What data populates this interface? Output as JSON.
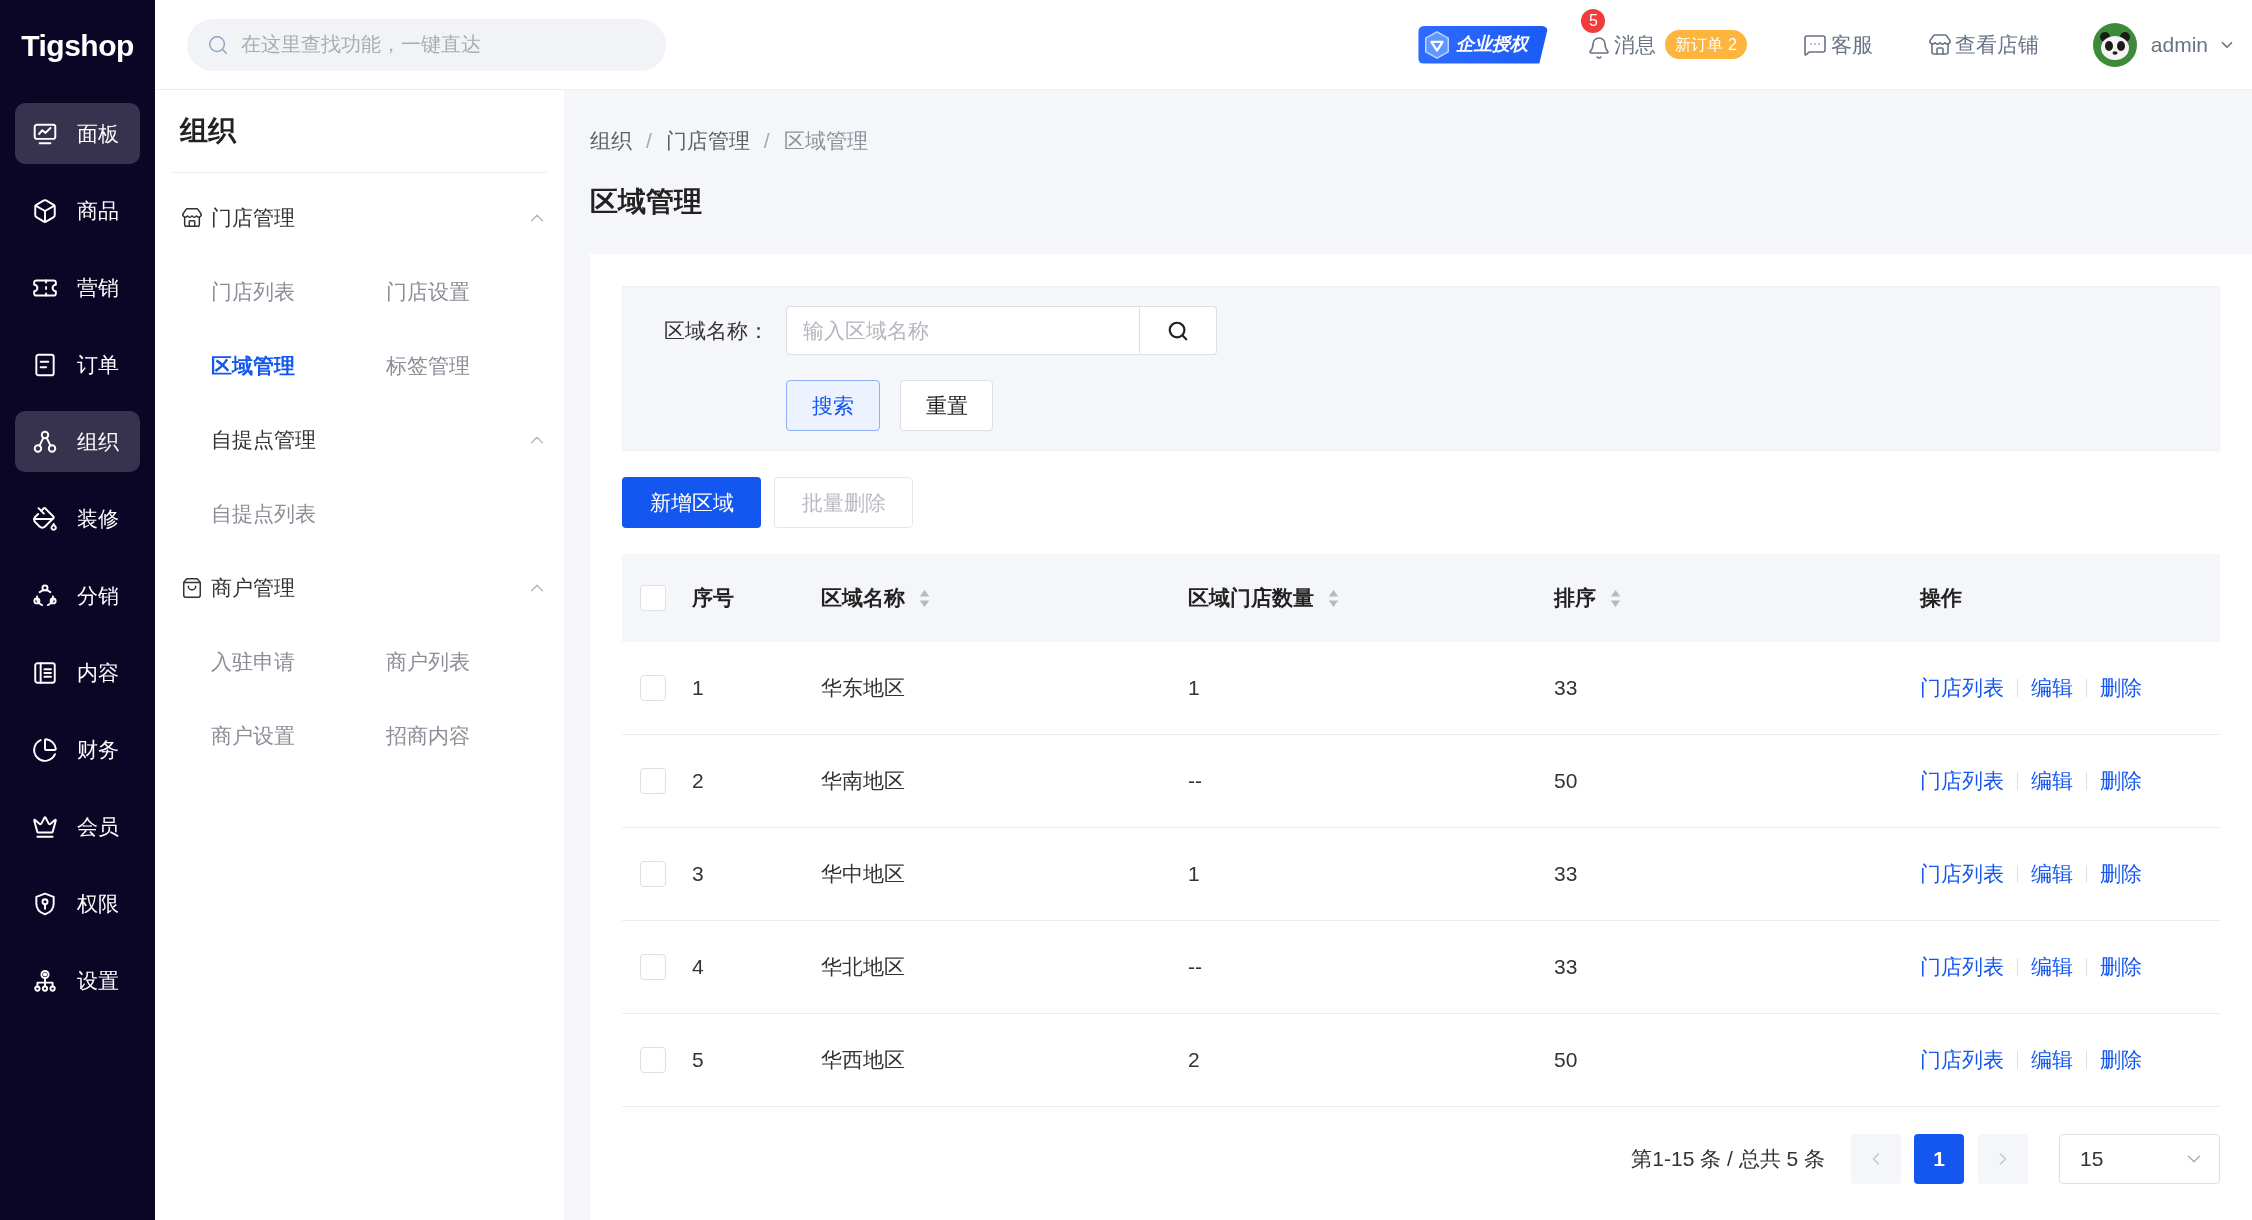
{
  "logo": {
    "text": "Tigshop"
  },
  "topbar": {
    "search": {
      "placeholder": "在这里查找功能，一键直达"
    },
    "license_badge": "企业授权",
    "messages": {
      "label": "消息",
      "count": "5"
    },
    "new_orders": "新订单 2",
    "service": "客服",
    "view_store": "查看店铺",
    "user": {
      "name": "admin"
    }
  },
  "sidebar": {
    "items": [
      {
        "label": "面板",
        "selected": true
      },
      {
        "label": "商品",
        "selected": false
      },
      {
        "label": "营销",
        "selected": false
      },
      {
        "label": "订单",
        "selected": false
      },
      {
        "label": "组织",
        "selected": true
      },
      {
        "label": "装修",
        "selected": false
      },
      {
        "label": "分销",
        "selected": false
      },
      {
        "label": "内容",
        "selected": false
      },
      {
        "label": "财务",
        "selected": false
      },
      {
        "label": "会员",
        "selected": false
      },
      {
        "label": "权限",
        "selected": false
      },
      {
        "label": "设置",
        "selected": false
      }
    ]
  },
  "submenu": {
    "title": "组织",
    "groups": [
      {
        "label": "门店管理",
        "expanded": true,
        "children": [
          {
            "label": "门店列表",
            "selected": false
          },
          {
            "label": "门店设置",
            "selected": false
          },
          {
            "label": "区域管理",
            "selected": true
          },
          {
            "label": "标签管理",
            "selected": false
          },
          {
            "label": "自提点管理",
            "expanded": true,
            "children": [
              {
                "label": "自提点列表",
                "selected": false
              }
            ]
          }
        ]
      },
      {
        "label": "商户管理",
        "expanded": true,
        "children": [
          {
            "label": "入驻申请",
            "selected": false
          },
          {
            "label": "商户列表",
            "selected": false
          },
          {
            "label": "商户设置",
            "selected": false
          },
          {
            "label": "招商内容",
            "selected": false
          }
        ]
      }
    ]
  },
  "breadcrumb": {
    "separator": "/",
    "items": [
      "组织",
      "门店管理",
      "区域管理"
    ]
  },
  "page_title": "区域管理",
  "filter": {
    "label": "区域名称：",
    "placeholder": "输入区域名称",
    "search_button": "搜索",
    "reset_button": "重置"
  },
  "actions": {
    "add_button": "新增区域",
    "batch_delete": {
      "label": "批量删除",
      "disabled": true
    }
  },
  "table": {
    "select_all": {
      "checked": false
    },
    "columns": [
      {
        "label": "序号",
        "sortable": false
      },
      {
        "label": "区域名称",
        "sortable": true
      },
      {
        "label": "区域门店数量",
        "sortable": true
      },
      {
        "label": "排序",
        "sortable": true
      },
      {
        "label": "操作",
        "sortable": false
      }
    ],
    "rows": [
      {
        "checked": false,
        "cells": [
          "1",
          "华东地区",
          "1",
          "33"
        ],
        "actions": [
          "门店列表",
          "编辑",
          "删除"
        ]
      },
      {
        "checked": false,
        "cells": [
          "2",
          "华南地区",
          "--",
          "50"
        ],
        "actions": [
          "门店列表",
          "编辑",
          "删除"
        ]
      },
      {
        "checked": false,
        "cells": [
          "3",
          "华中地区",
          "1",
          "33"
        ],
        "actions": [
          "门店列表",
          "编辑",
          "删除"
        ]
      },
      {
        "checked": false,
        "cells": [
          "4",
          "华北地区",
          "--",
          "33"
        ],
        "actions": [
          "门店列表",
          "编辑",
          "删除"
        ]
      },
      {
        "checked": false,
        "cells": [
          "5",
          "华西地区",
          "2",
          "50"
        ],
        "actions": [
          "门店列表",
          "编辑",
          "删除"
        ]
      }
    ]
  },
  "pagination": {
    "summary": "第1-15 条 / 总共 5 条",
    "prev": {
      "disabled": true
    },
    "pages": [
      {
        "label": "1",
        "selected": true
      }
    ],
    "next": {
      "disabled": true
    },
    "page_size": "15"
  }
}
